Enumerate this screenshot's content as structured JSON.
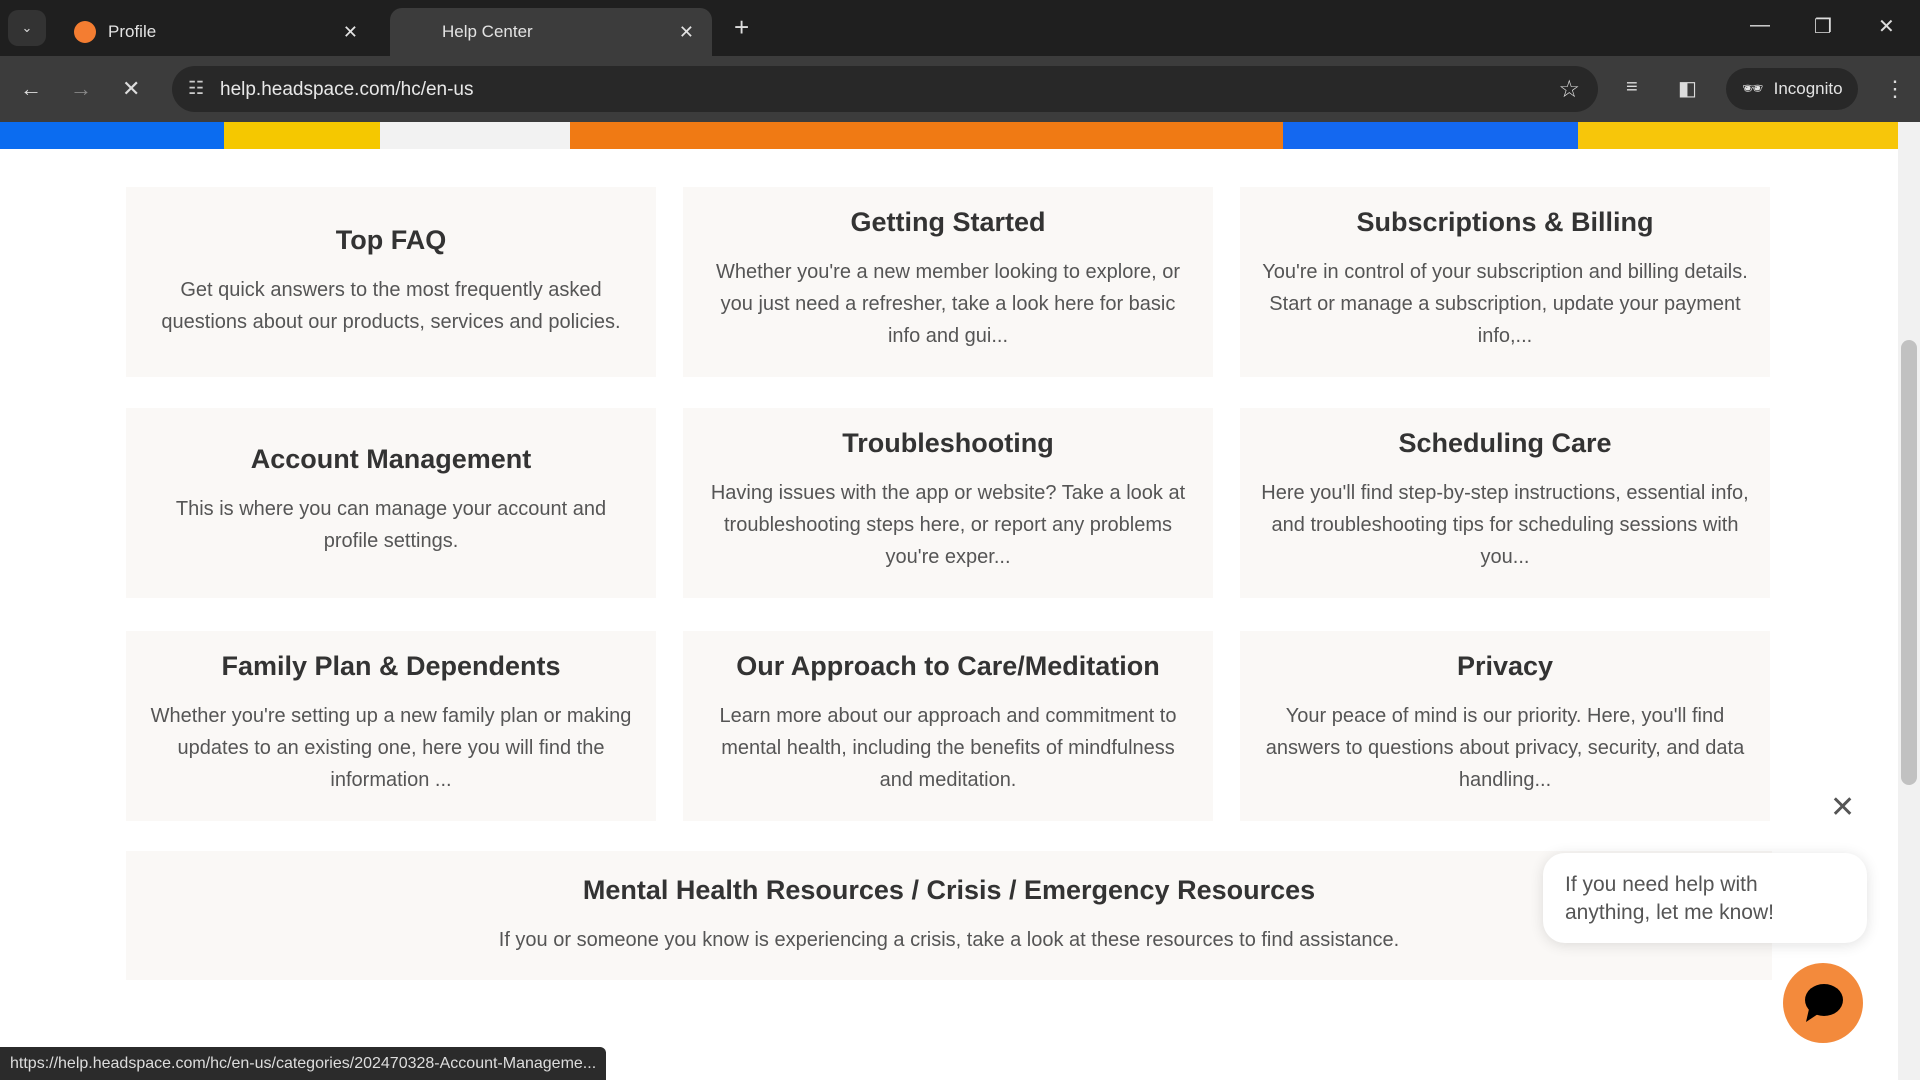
{
  "browser": {
    "tabs": [
      {
        "title": "Profile",
        "active": false
      },
      {
        "title": "Help Center",
        "active": true
      }
    ],
    "url": "help.headspace.com/hc/en-us",
    "profile_label": "Incognito",
    "status_url": "https://help.headspace.com/hc/en-us/categories/202470328-Account-Manageme..."
  },
  "categories": [
    {
      "title": "Top FAQ",
      "desc": "Get quick answers to the most frequently asked questions about our products, services and policies."
    },
    {
      "title": "Getting Started",
      "desc": "Whether you're a new member looking to explore, or you just need a refresher, take a look here for basic info and gui..."
    },
    {
      "title": "Subscriptions & Billing",
      "desc": "You're in control of your subscription and billing details. Start or manage a subscription, update your payment info,..."
    },
    {
      "title": "Account Management",
      "desc": "This is where you can manage your account and profile settings."
    },
    {
      "title": "Troubleshooting",
      "desc": "Having issues with the app or website? Take a look at troubleshooting steps here, or report any problems you're exper..."
    },
    {
      "title": "Scheduling Care",
      "desc": "Here you'll find step-by-step instructions, essential info, and troubleshooting tips for scheduling sessions with you..."
    },
    {
      "title": "Family Plan & Dependents",
      "desc": "Whether you're setting up a new family plan or making updates to an existing one, here you will find the information ..."
    },
    {
      "title": "Our Approach to Care/Meditation",
      "desc": "Learn more about our approach and commitment to mental health, including the benefits of mindfulness and meditation."
    },
    {
      "title": "Privacy",
      "desc": "Your peace of mind is our priority. Here, you'll find answers to questions about privacy, security, and data handling..."
    },
    {
      "title": "Mental Health Resources / Crisis / Emergency Resources",
      "desc": "If you or someone you know is experiencing a crisis, take a look at these resources to find assistance."
    }
  ],
  "chat": {
    "message": "If you need help with anything, let me know!",
    "accent": "#f38a3c"
  }
}
